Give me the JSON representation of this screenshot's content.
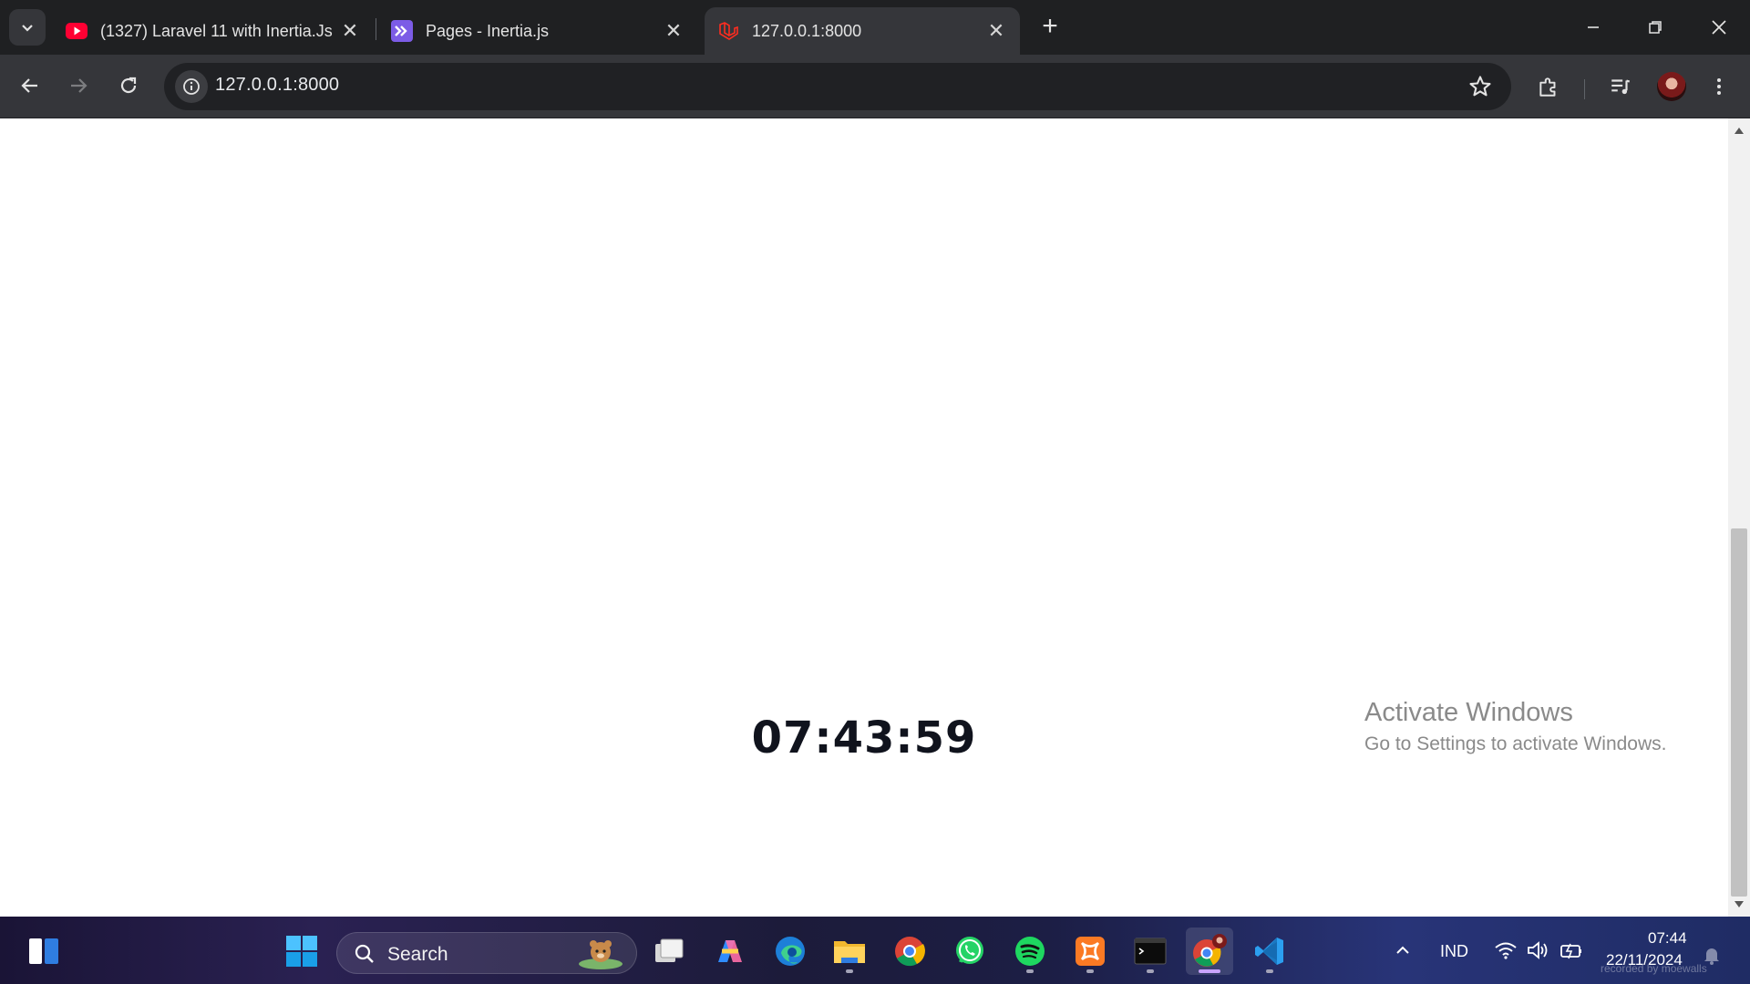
{
  "browser": {
    "tabs": [
      {
        "title": "(1327) Laravel 11 with Inertia.Js",
        "icon": "youtube-icon",
        "active": false
      },
      {
        "title": "Pages - Inertia.js",
        "icon": "inertia-icon",
        "active": false
      },
      {
        "title": "127.0.0.1:8000",
        "icon": "laravel-icon",
        "active": true
      }
    ],
    "address": "127.0.0.1:8000"
  },
  "page": {
    "clock": "07:43:59"
  },
  "activation": {
    "heading": "Activate Windows",
    "subtext": "Go to Settings to activate Windows."
  },
  "taskbar": {
    "search_label": "Search",
    "apps": [
      "start-icon",
      "task-view-icon",
      "copilot-icon",
      "edge-icon",
      "file-explorer-icon",
      "chrome-icon",
      "whatsapp-icon",
      "spotify-icon",
      "xampp-icon",
      "terminal-icon",
      "chrome-profile-icon",
      "vscode-icon"
    ],
    "tray": {
      "language": "IND",
      "time": "07:44",
      "date": "22/11/2024"
    },
    "watermark": "recorded by moewalls"
  },
  "colors": {
    "chrome_dark": "#1f2022",
    "toolbar": "#35363a",
    "clock_text": "#10131d"
  }
}
